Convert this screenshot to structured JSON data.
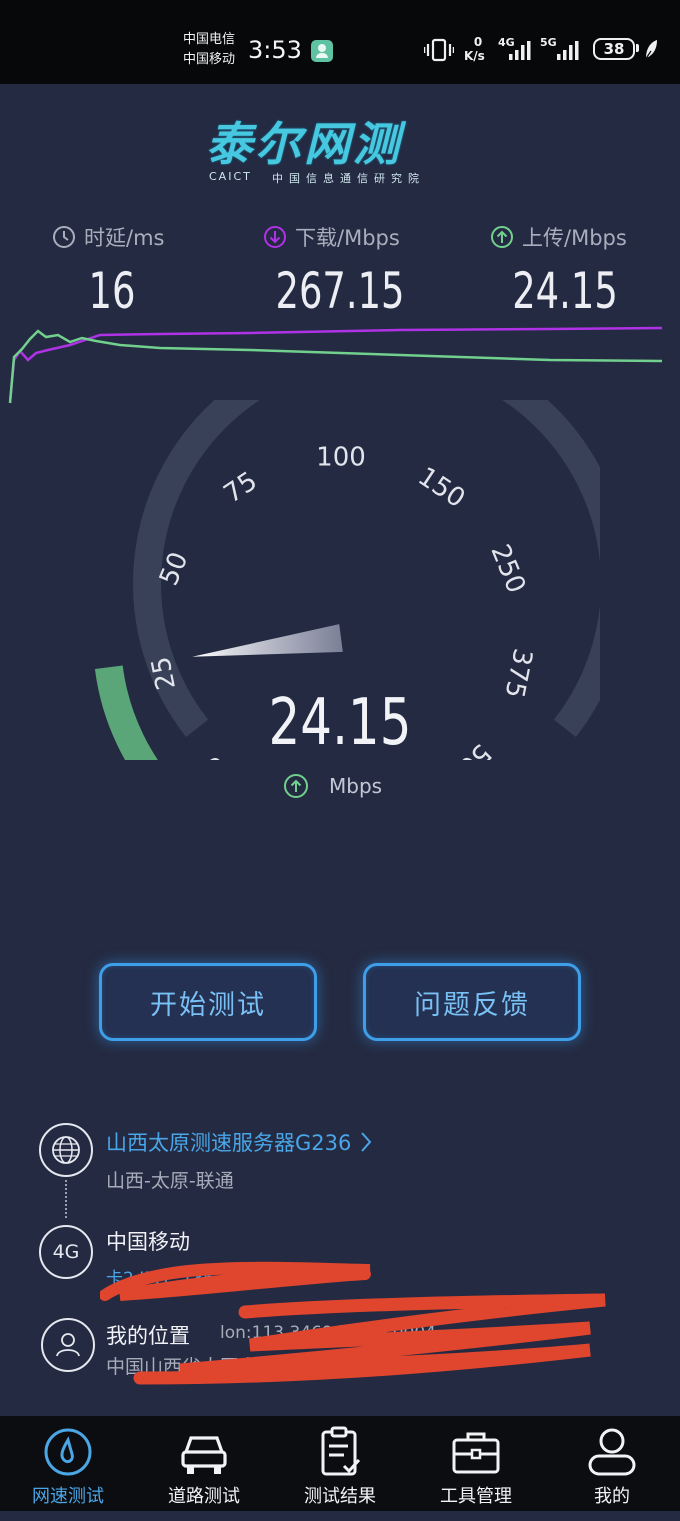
{
  "status_bar": {
    "carrier_1": "中国电信",
    "carrier_2": "中国移动",
    "time": "3:53",
    "net_speed_value": "0",
    "net_speed_unit": "K/s",
    "sim1_network": "4G",
    "sim2_network": "5G",
    "battery": "38"
  },
  "logo": {
    "title": "泰尔网测",
    "sub_left": "CAICT",
    "sub_right": "中国信息通信研究院"
  },
  "metrics": {
    "latency": {
      "label": "时延/ms",
      "value": "16"
    },
    "download": {
      "label": "下载/Mbps",
      "value": "267.15"
    },
    "upload": {
      "label": "上传/Mbps",
      "value": "24.15"
    }
  },
  "gauge": {
    "ticks": [
      "0",
      "25",
      "50",
      "75",
      "100",
      "150",
      "250",
      "375",
      "500"
    ],
    "value": "24.15",
    "unit": "Mbps",
    "fraction": 0.14
  },
  "buttons": {
    "start": "开始测试",
    "feedback": "问题反馈"
  },
  "info": {
    "server_name": "山西太原测速服务器G236",
    "server_location": "山西-太原-联通",
    "network_badge": "4G",
    "operator": "中国移动",
    "operator_detail": "卡2 IP:1 .136.4.172",
    "location_title": "我的位置",
    "location_coords": "lon:113.3469  lat:40.0004",
    "location_address": "中国山西省大同市"
  },
  "nav": [
    {
      "label": "网速测试",
      "icon": "speedometer-icon",
      "active": true
    },
    {
      "label": "道路测试",
      "icon": "car-icon",
      "active": false
    },
    {
      "label": "测试结果",
      "icon": "clipboard-check-icon",
      "active": false
    },
    {
      "label": "工具管理",
      "icon": "toolbox-icon",
      "active": false
    },
    {
      "label": "我的",
      "icon": "user-icon",
      "active": false
    }
  ],
  "colors": {
    "background": "#242a41",
    "download_line": "#b032e6",
    "upload_line": "#72d08e",
    "accent_blue": "#49a6e8",
    "gauge_track": "#394158",
    "gauge_fill": "#5aa678",
    "redaction": "#e0452e"
  }
}
